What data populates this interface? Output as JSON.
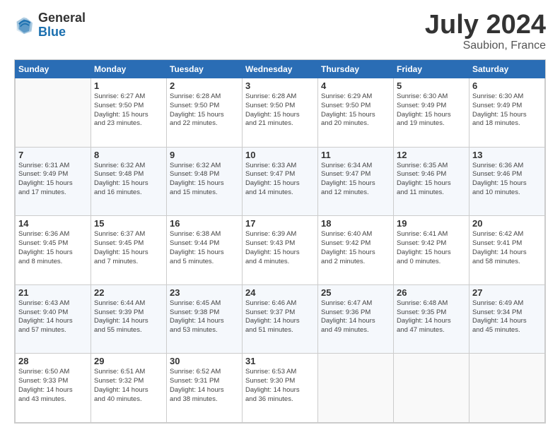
{
  "header": {
    "logo_general": "General",
    "logo_blue": "Blue",
    "title": "July 2024",
    "subtitle": "Saubion, France"
  },
  "weekdays": [
    "Sunday",
    "Monday",
    "Tuesday",
    "Wednesday",
    "Thursday",
    "Friday",
    "Saturday"
  ],
  "weeks": [
    [
      {
        "day": "",
        "info": ""
      },
      {
        "day": "1",
        "info": "Sunrise: 6:27 AM\nSunset: 9:50 PM\nDaylight: 15 hours\nand 23 minutes."
      },
      {
        "day": "2",
        "info": "Sunrise: 6:28 AM\nSunset: 9:50 PM\nDaylight: 15 hours\nand 22 minutes."
      },
      {
        "day": "3",
        "info": "Sunrise: 6:28 AM\nSunset: 9:50 PM\nDaylight: 15 hours\nand 21 minutes."
      },
      {
        "day": "4",
        "info": "Sunrise: 6:29 AM\nSunset: 9:50 PM\nDaylight: 15 hours\nand 20 minutes."
      },
      {
        "day": "5",
        "info": "Sunrise: 6:30 AM\nSunset: 9:49 PM\nDaylight: 15 hours\nand 19 minutes."
      },
      {
        "day": "6",
        "info": "Sunrise: 6:30 AM\nSunset: 9:49 PM\nDaylight: 15 hours\nand 18 minutes."
      }
    ],
    [
      {
        "day": "7",
        "info": "Sunrise: 6:31 AM\nSunset: 9:49 PM\nDaylight: 15 hours\nand 17 minutes."
      },
      {
        "day": "8",
        "info": "Sunrise: 6:32 AM\nSunset: 9:48 PM\nDaylight: 15 hours\nand 16 minutes."
      },
      {
        "day": "9",
        "info": "Sunrise: 6:32 AM\nSunset: 9:48 PM\nDaylight: 15 hours\nand 15 minutes."
      },
      {
        "day": "10",
        "info": "Sunrise: 6:33 AM\nSunset: 9:47 PM\nDaylight: 15 hours\nand 14 minutes."
      },
      {
        "day": "11",
        "info": "Sunrise: 6:34 AM\nSunset: 9:47 PM\nDaylight: 15 hours\nand 12 minutes."
      },
      {
        "day": "12",
        "info": "Sunrise: 6:35 AM\nSunset: 9:46 PM\nDaylight: 15 hours\nand 11 minutes."
      },
      {
        "day": "13",
        "info": "Sunrise: 6:36 AM\nSunset: 9:46 PM\nDaylight: 15 hours\nand 10 minutes."
      }
    ],
    [
      {
        "day": "14",
        "info": "Sunrise: 6:36 AM\nSunset: 9:45 PM\nDaylight: 15 hours\nand 8 minutes."
      },
      {
        "day": "15",
        "info": "Sunrise: 6:37 AM\nSunset: 9:45 PM\nDaylight: 15 hours\nand 7 minutes."
      },
      {
        "day": "16",
        "info": "Sunrise: 6:38 AM\nSunset: 9:44 PM\nDaylight: 15 hours\nand 5 minutes."
      },
      {
        "day": "17",
        "info": "Sunrise: 6:39 AM\nSunset: 9:43 PM\nDaylight: 15 hours\nand 4 minutes."
      },
      {
        "day": "18",
        "info": "Sunrise: 6:40 AM\nSunset: 9:42 PM\nDaylight: 15 hours\nand 2 minutes."
      },
      {
        "day": "19",
        "info": "Sunrise: 6:41 AM\nSunset: 9:42 PM\nDaylight: 15 hours\nand 0 minutes."
      },
      {
        "day": "20",
        "info": "Sunrise: 6:42 AM\nSunset: 9:41 PM\nDaylight: 14 hours\nand 58 minutes."
      }
    ],
    [
      {
        "day": "21",
        "info": "Sunrise: 6:43 AM\nSunset: 9:40 PM\nDaylight: 14 hours\nand 57 minutes."
      },
      {
        "day": "22",
        "info": "Sunrise: 6:44 AM\nSunset: 9:39 PM\nDaylight: 14 hours\nand 55 minutes."
      },
      {
        "day": "23",
        "info": "Sunrise: 6:45 AM\nSunset: 9:38 PM\nDaylight: 14 hours\nand 53 minutes."
      },
      {
        "day": "24",
        "info": "Sunrise: 6:46 AM\nSunset: 9:37 PM\nDaylight: 14 hours\nand 51 minutes."
      },
      {
        "day": "25",
        "info": "Sunrise: 6:47 AM\nSunset: 9:36 PM\nDaylight: 14 hours\nand 49 minutes."
      },
      {
        "day": "26",
        "info": "Sunrise: 6:48 AM\nSunset: 9:35 PM\nDaylight: 14 hours\nand 47 minutes."
      },
      {
        "day": "27",
        "info": "Sunrise: 6:49 AM\nSunset: 9:34 PM\nDaylight: 14 hours\nand 45 minutes."
      }
    ],
    [
      {
        "day": "28",
        "info": "Sunrise: 6:50 AM\nSunset: 9:33 PM\nDaylight: 14 hours\nand 43 minutes."
      },
      {
        "day": "29",
        "info": "Sunrise: 6:51 AM\nSunset: 9:32 PM\nDaylight: 14 hours\nand 40 minutes."
      },
      {
        "day": "30",
        "info": "Sunrise: 6:52 AM\nSunset: 9:31 PM\nDaylight: 14 hours\nand 38 minutes."
      },
      {
        "day": "31",
        "info": "Sunrise: 6:53 AM\nSunset: 9:30 PM\nDaylight: 14 hours\nand 36 minutes."
      },
      {
        "day": "",
        "info": ""
      },
      {
        "day": "",
        "info": ""
      },
      {
        "day": "",
        "info": ""
      }
    ]
  ]
}
